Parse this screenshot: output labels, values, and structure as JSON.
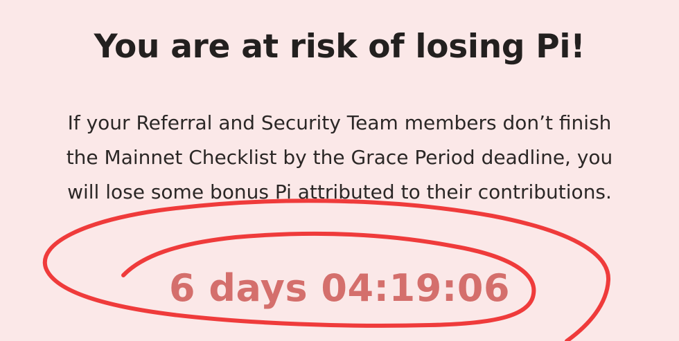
{
  "warning": {
    "title": "You are at risk of losing Pi!",
    "message": "If your Referral and Security Team members don’t finish the Mainnet Checklist by the Grace Period deadline, you will lose some bonus Pi attributed to their contributions.",
    "countdown": "6 days 04:19:06"
  },
  "colors": {
    "background": "#FBE8E8",
    "title_text": "#23201F",
    "body_text": "#2B2726",
    "countdown_text": "#D46F6C",
    "annotation_stroke": "#EF3B3B"
  }
}
